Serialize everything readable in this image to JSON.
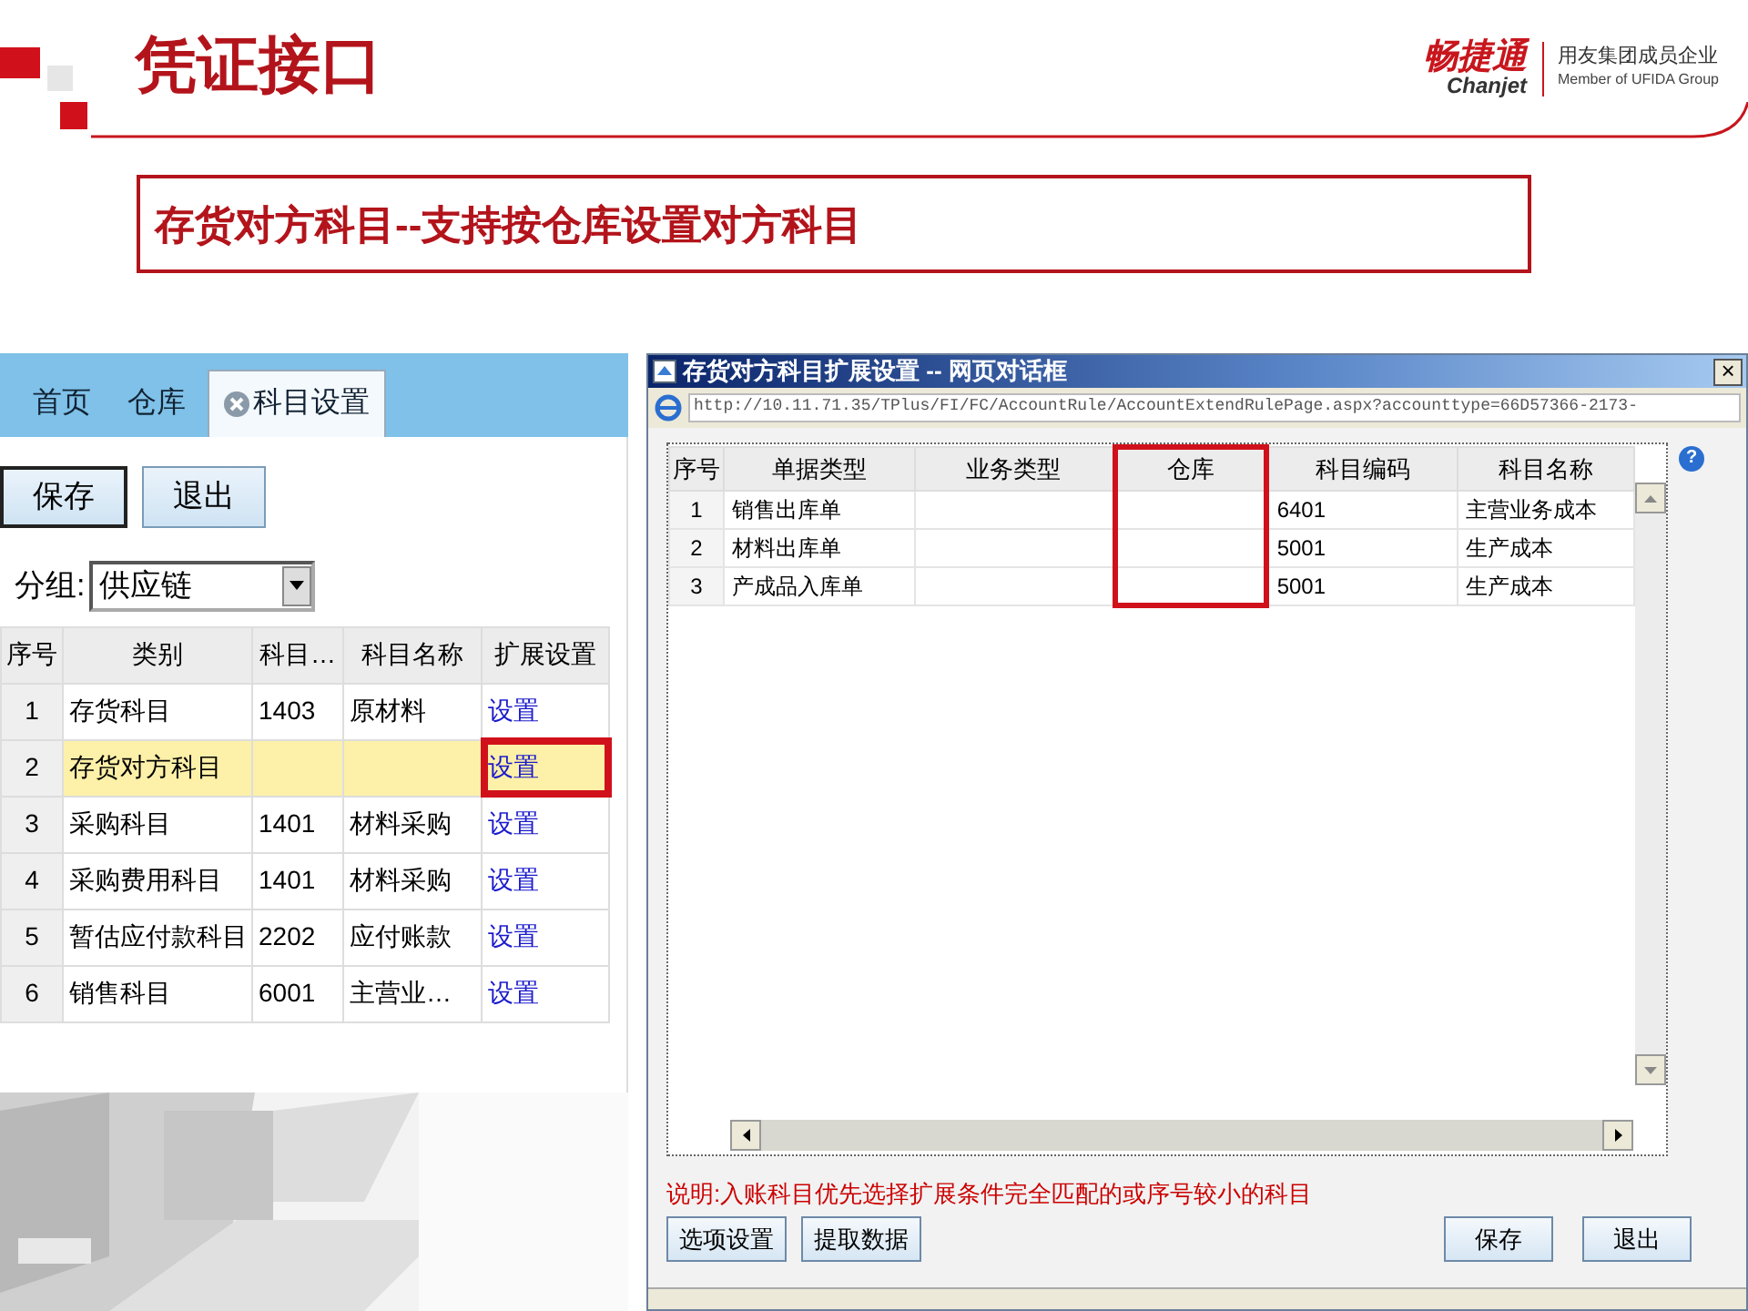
{
  "header": {
    "title": "凭证接口",
    "logo": {
      "brand": "畅捷通",
      "brand_latin": "Chanjet",
      "tagline": "用友集团成员企业",
      "tagline_en": "Member of UFIDA Group"
    }
  },
  "subtitle": "存货对方科目--支持按仓库设置对方科目",
  "left_app": {
    "tabs": [
      {
        "label": "首页",
        "selected": false,
        "closable": false
      },
      {
        "label": "仓库",
        "selected": false,
        "closable": false
      },
      {
        "label": "科目设置",
        "selected": true,
        "closable": true
      }
    ],
    "buttons": [
      {
        "label": "保存",
        "focused": true
      },
      {
        "label": "退出",
        "focused": false
      }
    ],
    "group": {
      "label": "分组:",
      "value": "供应链"
    },
    "table": {
      "columns": [
        "序号",
        "类别",
        "科目…",
        "科目名称",
        "扩展设置"
      ],
      "rows": [
        {
          "cells": [
            "1",
            "存货科目",
            "1403",
            "原材料"
          ],
          "link": "设置",
          "selected": false,
          "callout": false
        },
        {
          "cells": [
            "2",
            "存货对方科目",
            "",
            ""
          ],
          "link": "设置",
          "selected": true,
          "callout": true
        },
        {
          "cells": [
            "3",
            "采购科目",
            "1401",
            "材料采购"
          ],
          "link": "设置",
          "selected": false,
          "callout": false
        },
        {
          "cells": [
            "4",
            "采购费用科目",
            "1401",
            "材料采购"
          ],
          "link": "设置",
          "selected": false,
          "callout": false
        },
        {
          "cells": [
            "5",
            "暂估应付款科目",
            "2202",
            "应付账款"
          ],
          "link": "设置",
          "selected": false,
          "callout": false
        },
        {
          "cells": [
            "6",
            "销售科目",
            "6001",
            "主营业…"
          ],
          "link": "设置",
          "selected": false,
          "callout": false
        }
      ]
    }
  },
  "dialog": {
    "title": "存货对方科目扩展设置 -- 网页对话框",
    "close": "×",
    "url": "http://10.11.71.35/TPlus/FI/FC/AccountRule/AccountExtendRulePage.aspx?accounttype=66D57366-2173-",
    "help": "?",
    "table": {
      "columns": [
        {
          "label": "序号",
          "callout": false
        },
        {
          "label": "单据类型",
          "callout": false
        },
        {
          "label": "业务类型",
          "callout": false
        },
        {
          "label": "仓库",
          "callout": true
        },
        {
          "label": "科目编码",
          "callout": false
        },
        {
          "label": "科目名称",
          "callout": false
        }
      ],
      "rows": [
        [
          "1",
          "销售出库单",
          "",
          "",
          "6401",
          "主营业务成本"
        ],
        [
          "2",
          "材料出库单",
          "",
          "",
          "5001",
          "生产成本"
        ],
        [
          "3",
          "产成品入库单",
          "",
          "",
          "5001",
          "生产成本"
        ]
      ]
    },
    "note": "说明:入账科目优先选择扩展条件完全匹配的或序号较小的科目",
    "left_buttons": [
      "选项设置",
      "提取数据"
    ],
    "right_buttons": [
      "保存",
      "退出"
    ]
  }
}
